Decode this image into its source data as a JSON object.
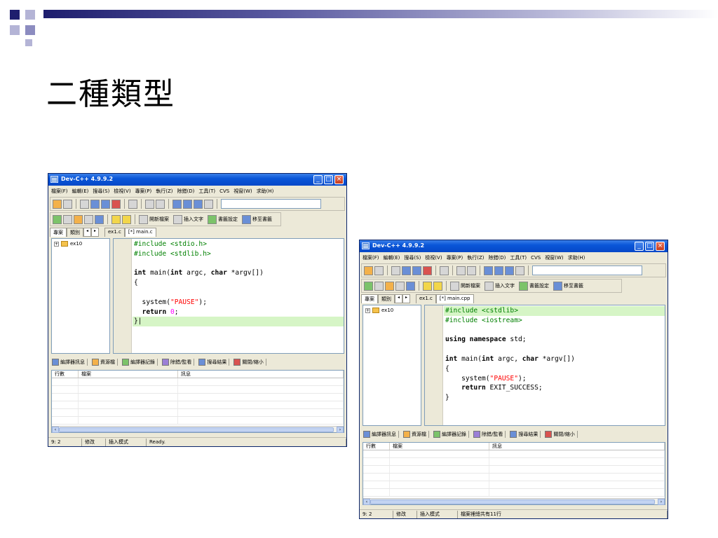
{
  "slide": {
    "title": "二種類型",
    "colors": {
      "accent_dark": "#1e1e6e",
      "accent_light": "#8c8cc0"
    }
  },
  "ide": {
    "title": "Dev-C++ 4.9.9.2",
    "menu": [
      "檔案(F)",
      "編輯(E)",
      "搜尋(S)",
      "檢視(V)",
      "專案(P)",
      "執行(Z)",
      "除錯(D)",
      "工具(T)",
      "CVS",
      "視窗(W)",
      "求助(H)"
    ],
    "toolbar2_labels": {
      "new_file": "開新檔案",
      "insert_text": "插入文字",
      "set_bookmark": "書籤設定",
      "goto_bookmark": "移至書籤"
    },
    "project_tabs": [
      "專案",
      "類別"
    ],
    "bottom_tabs": [
      "編譯器訊息",
      "資源檔",
      "編譯器記錄",
      "除錯/監看",
      "搜尋結果",
      "關閉/縮小"
    ],
    "grid_headers": [
      "行數",
      "檔案",
      "訊息"
    ]
  },
  "windows": [
    {
      "file_tabs": [
        "ex1.c",
        "[*] main.c"
      ],
      "tree_item": "ex10",
      "code_lines": [
        [
          {
            "t": "#include <stdio.h>",
            "c": "pre"
          }
        ],
        [
          {
            "t": "#include <stdlib.h>",
            "c": "pre"
          }
        ],
        [
          {
            "t": ""
          }
        ],
        [
          {
            "t": "int",
            "c": "kw"
          },
          {
            "t": " main("
          },
          {
            "t": "int",
            "c": "kw"
          },
          {
            "t": " argc, "
          },
          {
            "t": "char",
            "c": "kw"
          },
          {
            "t": " *argv[])"
          }
        ],
        [
          {
            "t": "{"
          }
        ],
        [
          {
            "t": ""
          }
        ],
        [
          {
            "t": "  system("
          },
          {
            "t": "\"PAUSE\"",
            "c": "str"
          },
          {
            "t": ");"
          }
        ],
        [
          {
            "t": "  "
          },
          {
            "t": "return",
            "c": "kw"
          },
          {
            "t": " "
          },
          {
            "t": "0",
            "c": "num"
          },
          {
            "t": ";"
          }
        ],
        [
          {
            "t": "}|"
          }
        ]
      ],
      "highlight_line": 8,
      "status": {
        "position": "9: 2",
        "modified": "修改",
        "insert_mode": "插入模式",
        "message": "Ready."
      }
    },
    {
      "file_tabs": [
        "ex1.c",
        "[*] main.cpp"
      ],
      "tree_item": "ex10",
      "code_lines": [
        [
          {
            "t": "#include <cstdlib>",
            "c": "pre"
          }
        ],
        [
          {
            "t": "#include <iostream>",
            "c": "pre"
          }
        ],
        [
          {
            "t": ""
          }
        ],
        [
          {
            "t": "using",
            "c": "kw"
          },
          {
            "t": " "
          },
          {
            "t": "namespace",
            "c": "kw"
          },
          {
            "t": " std;"
          }
        ],
        [
          {
            "t": ""
          }
        ],
        [
          {
            "t": "int",
            "c": "kw"
          },
          {
            "t": " main("
          },
          {
            "t": "int",
            "c": "kw"
          },
          {
            "t": " argc, "
          },
          {
            "t": "char",
            "c": "kw"
          },
          {
            "t": " *argv[])"
          }
        ],
        [
          {
            "t": "{"
          }
        ],
        [
          {
            "t": "    system("
          },
          {
            "t": "\"PAUSE\"",
            "c": "str"
          },
          {
            "t": ");"
          }
        ],
        [
          {
            "t": "    "
          },
          {
            "t": "return",
            "c": "kw"
          },
          {
            "t": " EXIT_SUCCESS;"
          }
        ],
        [
          {
            "t": "}"
          }
        ]
      ],
      "highlight_line": 0,
      "status": {
        "position": "9: 2",
        "modified": "修改",
        "insert_mode": "插入模式",
        "message": "檔案裡總共有11行"
      }
    }
  ]
}
